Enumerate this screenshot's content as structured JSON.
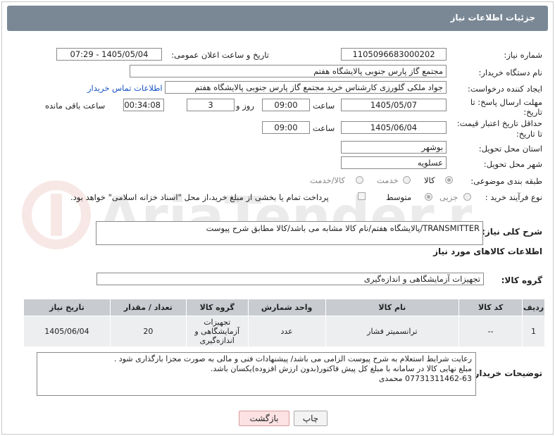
{
  "header": {
    "title": "جزئیات اطلاعات نیاز"
  },
  "watermark_text": "AriaTender.net",
  "fields": {
    "need_number_label": "شماره نیاز:",
    "need_number": "1105096683000202",
    "announce_label": "تاریخ و ساعت اعلان عمومی:",
    "announce_value": "1405/05/04 - 07:29",
    "buyer_org_label": "نام دستگاه خریدار:",
    "buyer_org": "مجتمع گاز پارس جنوبی  پالایشگاه هفتم",
    "creator_label": "ایجاد کننده درخواست:",
    "creator": "جواد ملکی گلورزی کارشناس خرید مجتمع گاز پارس جنوبی  پالایشگاه هفتم",
    "contact_link": "اطلاعات تماس خریدار",
    "reply_deadline_label_1": "مهلت ارسال پاسخ: تا",
    "reply_deadline_label_2": "تاریخ:",
    "reply_date": "1405/05/07",
    "time_label": "ساعت",
    "reply_time": "09:00",
    "day_and_label": "روز و",
    "days": "3",
    "remaining": "00:34:08",
    "remaining_label": "ساعت باقی مانده",
    "min_validity_label_1": "حداقل تاریخ اعتبار قیمت:",
    "min_validity_label_2": "تا تاریخ:",
    "validity_date": "1405/06/04",
    "validity_time": "09:00",
    "province_label": "استان محل تحویل:",
    "province": "بوشهر",
    "city_label": "شهر محل تحویل:",
    "city": "عسلویه",
    "category_label": "طبقه بندی موضوعی:",
    "category_options": [
      "کالا",
      "خدمت",
      "کالا/خدمت"
    ],
    "process_label": "نوع فرآیند خرید :",
    "process_options": [
      "جزیی",
      "متوسط"
    ],
    "payment_note": "پرداخت تمام یا بخشی از مبلغ خرید،از محل \"اسناد خزانه اسلامی\" خواهد بود.",
    "summary_label": "شرح کلی نیاز:",
    "summary": "TRANSMITTER/پالایشگاه هفتم/نام کالا مشابه می باشد/کالا مطابق شرح پیوست",
    "goods_info_title": "اطلاعات کالاهای مورد نیاز",
    "goods_group_label": "گروه کالا:",
    "goods_group": "تجهیزات آزمایشگاهی و اندازه‌گیری",
    "buyer_notes_label": "توضیحات خریدار:",
    "buyer_notes": [
      "رعایت شرایط استعلام به شرح پیوست الزامی می باشد/ پیشنهادات فنی و مالی به صورت مجزا بارگذاری شود .",
      "مبلغ نهایی کالا در سامانه با مبلغ کل پیش فاکتور(بدون ارزش افزوده)یکسان باشد.",
      "07731311462-63 محمدی"
    ]
  },
  "table": {
    "headers": [
      "ردیف",
      "کد کالا",
      "نام کالا",
      "واحد شمارش",
      "گروه کالا",
      "تعداد / مقدار",
      "تاریخ نیاز"
    ],
    "rows": [
      [
        "1",
        "--",
        "ترانسمیتر فشار",
        "عدد",
        "تجهیزات آزمایشگاهی و اندازه‌گیری",
        "20",
        "1405/06/04"
      ]
    ]
  },
  "buttons": {
    "print": "چاپ",
    "back": "بازگشت"
  }
}
